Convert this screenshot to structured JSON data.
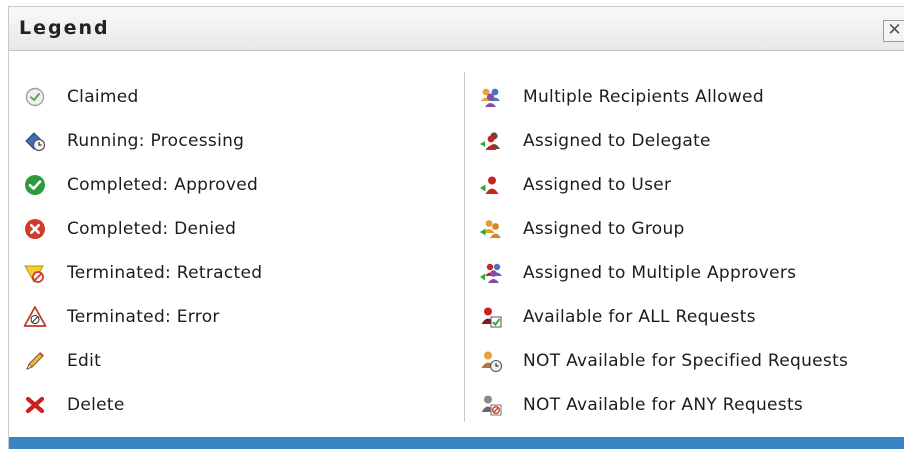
{
  "dialog": {
    "title": "Legend",
    "close_glyph": "✕"
  },
  "left_items": [
    {
      "icon": "claimed-icon",
      "label": "Claimed"
    },
    {
      "icon": "running-processing-icon",
      "label": "Running: Processing"
    },
    {
      "icon": "completed-approved-icon",
      "label": "Completed: Approved"
    },
    {
      "icon": "completed-denied-icon",
      "label": "Completed: Denied"
    },
    {
      "icon": "terminated-retracted-icon",
      "label": "Terminated: Retracted"
    },
    {
      "icon": "terminated-error-icon",
      "label": "Terminated: Error"
    },
    {
      "icon": "edit-icon",
      "label": "Edit"
    },
    {
      "icon": "delete-icon",
      "label": "Delete"
    }
  ],
  "right_items": [
    {
      "icon": "multiple-recipients-icon",
      "label": "Multiple Recipients Allowed"
    },
    {
      "icon": "assigned-delegate-icon",
      "label": "Assigned to Delegate"
    },
    {
      "icon": "assigned-user-icon",
      "label": "Assigned to User"
    },
    {
      "icon": "assigned-group-icon",
      "label": "Assigned to Group"
    },
    {
      "icon": "assigned-multiple-approvers-icon",
      "label": "Assigned to Multiple Approvers"
    },
    {
      "icon": "available-all-requests-icon",
      "label": "Available for ALL Requests"
    },
    {
      "icon": "not-available-specified-icon",
      "label": "NOT Available for Specified Requests"
    },
    {
      "icon": "not-available-any-icon",
      "label": "NOT Available for ANY Requests"
    }
  ],
  "colors": {
    "accent_bar": "#3a84c4",
    "approved_green": "#2e9b3a",
    "denied_red": "#d23a2a"
  }
}
